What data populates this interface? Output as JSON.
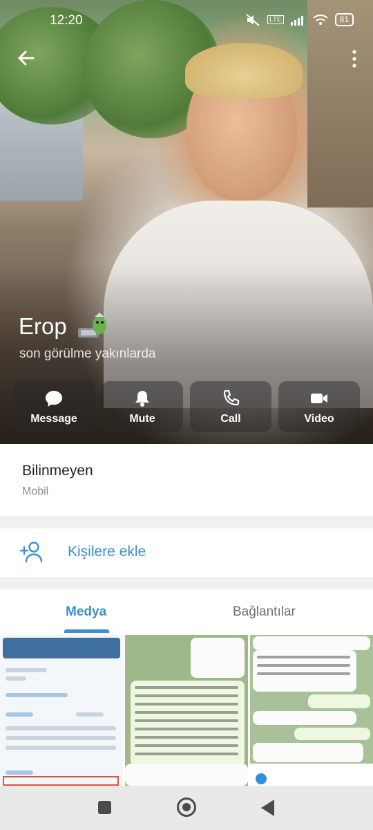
{
  "status_bar": {
    "time": "12:20",
    "battery": "81",
    "network": "LTE"
  },
  "profile": {
    "name": "Erop",
    "last_seen": "son görülme yakınlarda"
  },
  "actions": [
    {
      "label": "Message",
      "icon": "chat-bubble-icon"
    },
    {
      "label": "Mute",
      "icon": "bell-icon"
    },
    {
      "label": "Call",
      "icon": "phone-icon"
    },
    {
      "label": "Video",
      "icon": "video-camera-icon"
    }
  ],
  "info": {
    "phone_label": "Bilinmeyen",
    "phone_type": "Mobil"
  },
  "add_contact": {
    "label": "Kişilere ekle",
    "icon": "add-person-icon"
  },
  "tabs": {
    "media": "Medya",
    "links": "Bağlantılar"
  },
  "colors": {
    "accent": "#3a8fd0",
    "card": "#ffffff",
    "background": "#f0f0f0"
  }
}
